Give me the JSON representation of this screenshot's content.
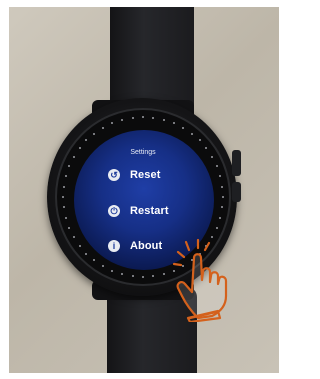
{
  "screen": {
    "title": "Settings",
    "menu": [
      {
        "label": "Reset",
        "icon": "reset-icon"
      },
      {
        "label": "Restart",
        "icon": "restart-icon"
      },
      {
        "label": "About",
        "icon": "info-icon"
      }
    ]
  },
  "overlay": {
    "icon": "tap-gesture-icon",
    "color": "#d4611c"
  },
  "colors": {
    "screen": "#1a3594",
    "icon_bg": "#e9ecf2",
    "text": "#ffffff"
  }
}
